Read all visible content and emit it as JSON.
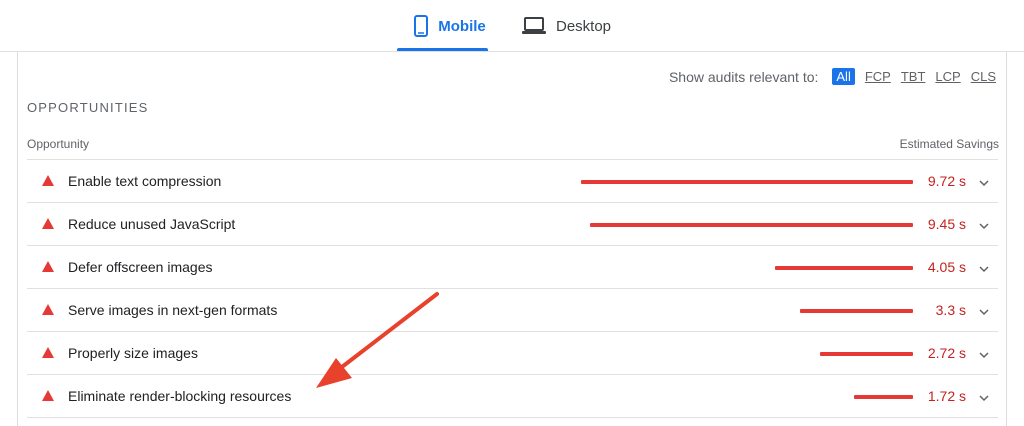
{
  "tabs": {
    "mobile_label": "Mobile",
    "desktop_label": "Desktop"
  },
  "filter": {
    "label": "Show audits relevant to:",
    "chips": [
      "All",
      "FCP",
      "TBT",
      "LCP",
      "CLS"
    ],
    "active": "All"
  },
  "section": {
    "title": "OPPORTUNITIES",
    "col_left": "Opportunity",
    "col_right": "Estimated Savings"
  },
  "opportunities": [
    {
      "title": "Enable text compression",
      "savings": "9.72 s",
      "savings_seconds": 9.72
    },
    {
      "title": "Reduce unused JavaScript",
      "savings": "9.45 s",
      "savings_seconds": 9.45
    },
    {
      "title": "Defer offscreen images",
      "savings": "4.05 s",
      "savings_seconds": 4.05
    },
    {
      "title": "Serve images in next-gen formats",
      "savings": "3.3 s",
      "savings_seconds": 3.3
    },
    {
      "title": "Properly size images",
      "savings": "2.72 s",
      "savings_seconds": 2.72
    },
    {
      "title": "Eliminate render-blocking resources",
      "savings": "1.72 s",
      "savings_seconds": 1.72
    }
  ],
  "colors": {
    "accent": "#1a73e8",
    "fail": "#e53935",
    "fail_text": "#c5221f",
    "annotation_arrow": "#e8412c"
  },
  "icons": {
    "mobile": "smartphone-icon",
    "desktop": "laptop-icon",
    "fail": "warning-triangle-icon",
    "expand": "chevron-down-icon"
  }
}
